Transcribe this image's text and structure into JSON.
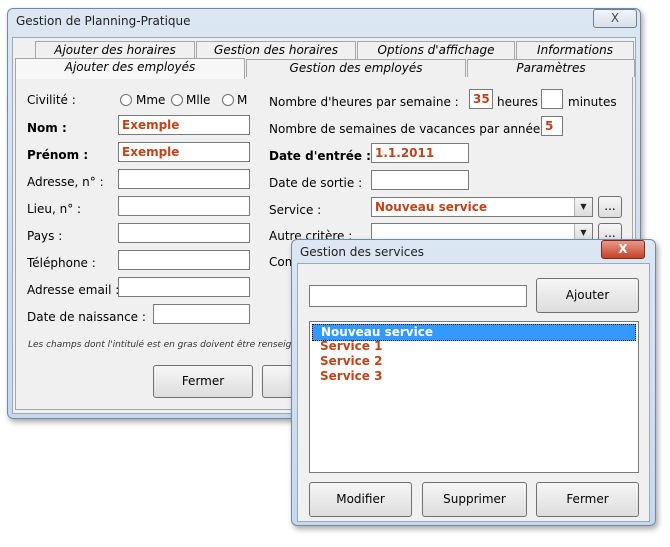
{
  "main_window": {
    "title": "Gestion de Planning-Pratique",
    "close_label": "X",
    "tabs_row1": [
      "Ajouter des horaires",
      "Gestion des horaires",
      "Options d'affichage",
      "Informations"
    ],
    "tabs_row2": [
      "Ajouter des employés",
      "Gestion des employés",
      "Paramètres"
    ],
    "form": {
      "civilite_label": "Civilité :",
      "civilite_options": [
        "Mme",
        "Mlle",
        "M"
      ],
      "nom_label": "Nom :",
      "nom_value": "Exemple",
      "prenom_label": "Prénom :",
      "prenom_value": "Exemple",
      "adresse_label": "Adresse, n° :",
      "lieu_label": "Lieu, n° :",
      "pays_label": "Pays :",
      "telephone_label": "Téléphone :",
      "email_label": "Adresse email :",
      "naissance_label": "Date de naissance :",
      "heures_label": "Nombre d'heures par semaine :",
      "heures_value": "35",
      "heures_unit": "heures",
      "minutes_value": "",
      "minutes_unit": "minutes",
      "vacances_label": "Nombre de semaines de vacances par année :",
      "vacances_value": "5",
      "entree_label": "Date d'entrée :",
      "entree_value": "1.1.2011",
      "sortie_label": "Date de sortie :",
      "service_label": "Service :",
      "service_value": "Nouveau service",
      "autre_label": "Autre critère :",
      "comm_label": "Com",
      "ellipsis": "...",
      "note": "Les champs dont l'intitulé est en gras doivent être renseigne"
    },
    "fermer_label": "Fermer"
  },
  "services_dialog": {
    "title": "Gestion des services",
    "close_label": "X",
    "search_value": "",
    "ajouter_label": "Ajouter",
    "services": [
      "Nouveau service",
      "Service 1",
      "Service 2",
      "Service 3"
    ],
    "selected_service": "Nouveau service",
    "modifier_label": "Modifier",
    "supprimer_label": "Supprimer",
    "fermer_label": "Fermer"
  }
}
